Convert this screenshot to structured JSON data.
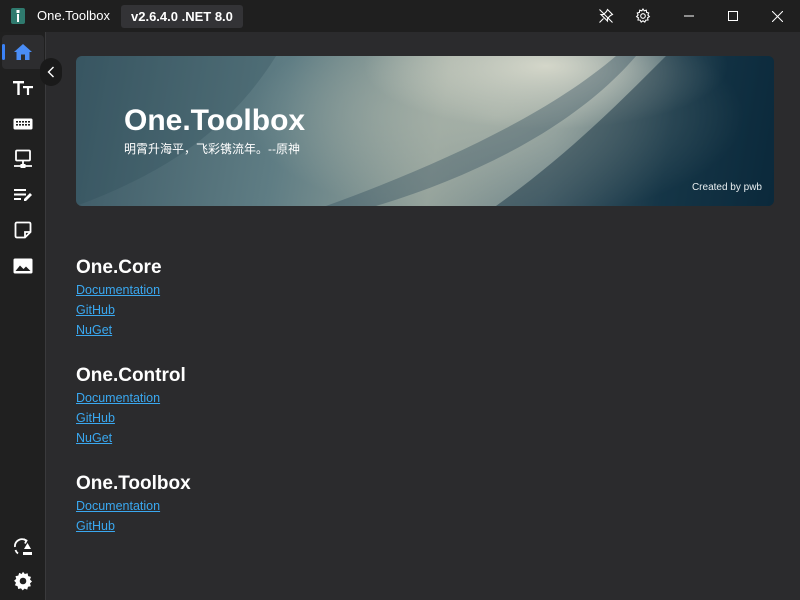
{
  "titlebar": {
    "app_name": "One.Toolbox",
    "version": "v2.6.4.0 .NET 8.0",
    "icons": [
      "app-icon",
      "pin-icon",
      "gear-icon",
      "minimize-icon",
      "maximize-icon",
      "close-icon"
    ]
  },
  "sidebar": {
    "items": [
      {
        "name": "home",
        "icon": "home-icon",
        "active": true
      },
      {
        "name": "font",
        "icon": "font-size-icon",
        "active": false
      },
      {
        "name": "keyboard",
        "icon": "keyboard-icon",
        "active": false
      },
      {
        "name": "network",
        "icon": "network-icon",
        "active": false
      },
      {
        "name": "notes",
        "icon": "edit-list-icon",
        "active": false
      },
      {
        "name": "sticky",
        "icon": "sticky-note-icon",
        "active": false
      },
      {
        "name": "image",
        "icon": "image-icon",
        "active": false
      }
    ],
    "bottom_items": [
      {
        "name": "update",
        "icon": "update-icon"
      },
      {
        "name": "settings",
        "icon": "gear-icon"
      }
    ],
    "collapse_icon": "chevron-left-icon",
    "accent_color": "#3b82f6"
  },
  "banner": {
    "title": "One.Toolbox",
    "subtitle": "明霄升海平，飞彩镌流年。--原神",
    "credit": "Created by pwb"
  },
  "sections": [
    {
      "title": "One.Core",
      "links": [
        "Documentation",
        "GitHub",
        "NuGet"
      ]
    },
    {
      "title": "One.Control",
      "links": [
        "Documentation",
        "GitHub",
        "NuGet"
      ]
    },
    {
      "title": "One.Toolbox",
      "links": [
        "Documentation",
        "GitHub"
      ]
    }
  ],
  "colors": {
    "background": "#2b2b2d",
    "link": "#3aa8f0",
    "titlebar": "#1f1f1f"
  }
}
